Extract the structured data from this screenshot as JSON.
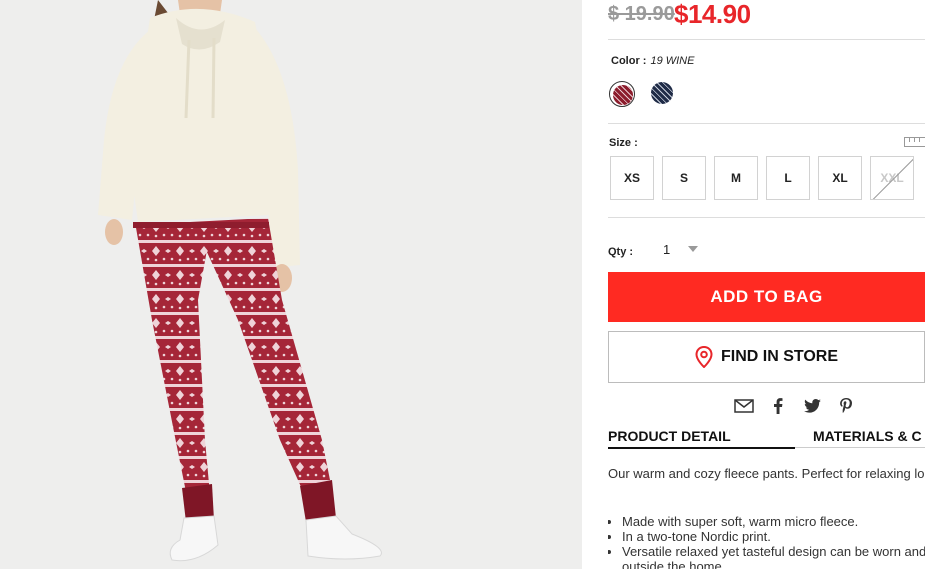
{
  "product": {
    "old_price": "$ 19.90",
    "new_price": "$14.90"
  },
  "color": {
    "label": "Color :",
    "selected": "19 WINE",
    "swatches": [
      {
        "name": "wine",
        "hex": "#8c1c2c"
      },
      {
        "name": "navy",
        "hex": "#1f2b46"
      }
    ]
  },
  "size": {
    "label": "Size :",
    "options": [
      {
        "label": "XS",
        "available": true
      },
      {
        "label": "S",
        "available": true
      },
      {
        "label": "M",
        "available": true
      },
      {
        "label": "L",
        "available": true
      },
      {
        "label": "XL",
        "available": true
      },
      {
        "label": "XXL",
        "available": false
      }
    ]
  },
  "qty": {
    "label": "Qty :",
    "value": "1"
  },
  "actions": {
    "add_to_bag": "ADD TO BAG",
    "find_in_store": "FIND IN STORE"
  },
  "share_icons": [
    "email-icon",
    "facebook-icon",
    "twitter-icon",
    "pinterest-icon"
  ],
  "tabs": {
    "product_detail": "PRODUCT DETAIL",
    "materials": "MATERIALS & C"
  },
  "description": {
    "text": "Our warm and cozy fleece pants. Perfect for relaxing long.",
    "bullets": [
      "Made with super soft, warm micro fleece.",
      "In a two-tone Nordic print.",
      "Versatile relaxed yet tasteful design can be worn and outside the home."
    ]
  },
  "colors": {
    "accent_red": "#ff2a22",
    "price_red": "#e8262a"
  }
}
